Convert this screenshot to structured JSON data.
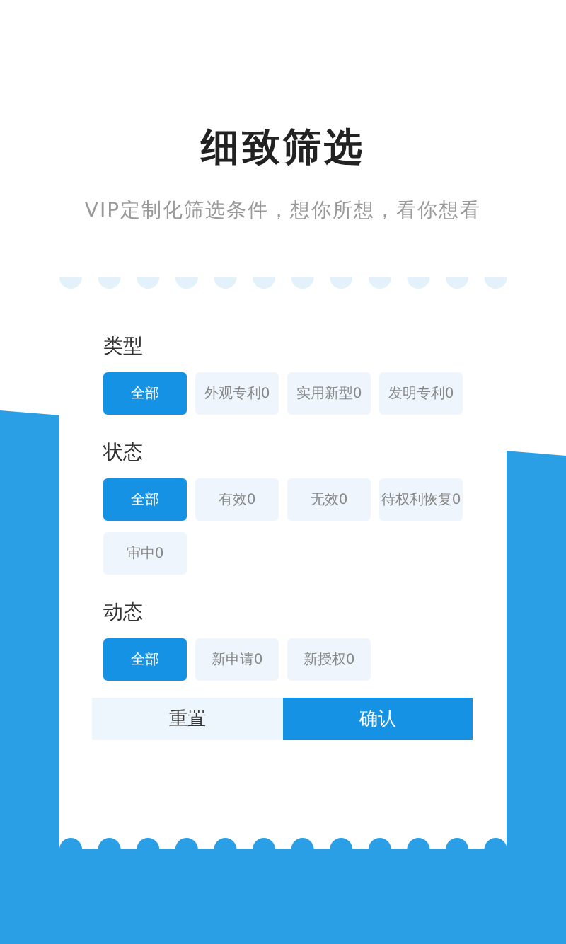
{
  "title": "细致筛选",
  "subtitle": "VIP定制化筛选条件，想你所想，看你想看",
  "filter_groups": [
    {
      "label": "类型",
      "options": [
        {
          "label": "全部",
          "selected": true
        },
        {
          "label": "外观专利0",
          "selected": false
        },
        {
          "label": "实用新型0",
          "selected": false
        },
        {
          "label": "发明专利0",
          "selected": false
        }
      ]
    },
    {
      "label": "状态",
      "options": [
        {
          "label": "全部",
          "selected": true
        },
        {
          "label": "有效0",
          "selected": false
        },
        {
          "label": "无效0",
          "selected": false
        },
        {
          "label": "待权利恢复0",
          "selected": false
        },
        {
          "label": "审中0",
          "selected": false
        }
      ]
    },
    {
      "label": "动态",
      "options": [
        {
          "label": "全部",
          "selected": true
        },
        {
          "label": "新申请0",
          "selected": false
        },
        {
          "label": "新授权0",
          "selected": false
        }
      ]
    }
  ],
  "buttons": [
    {
      "label": "重置",
      "kind": "secondary"
    },
    {
      "label": "确认",
      "kind": "primary"
    }
  ]
}
